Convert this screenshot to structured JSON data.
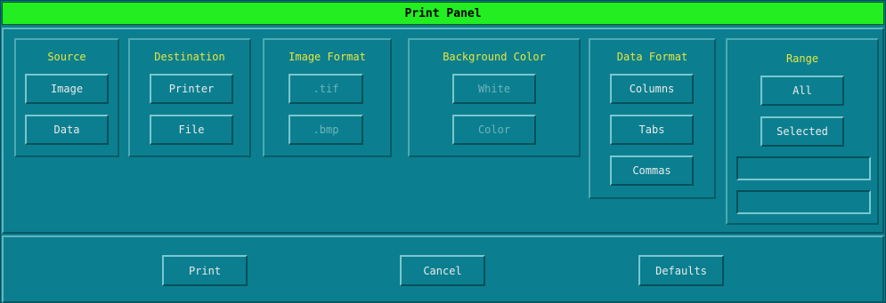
{
  "window": {
    "title": "Print Panel"
  },
  "source": {
    "title": "Source",
    "image": "Image",
    "data": "Data"
  },
  "destination": {
    "title": "Destination",
    "printer": "Printer",
    "file": "File"
  },
  "image_format": {
    "title": "Image Format",
    "tif": ".tif",
    "bmp": ".bmp"
  },
  "background_color": {
    "title": "Background Color",
    "white": "White",
    "color": "Color"
  },
  "data_format": {
    "title": "Data Format",
    "columns": "Columns",
    "tabs": "Tabs",
    "commas": "Commas"
  },
  "range": {
    "title": "Range",
    "all": "All",
    "selected": "Selected",
    "field1": "",
    "field2": ""
  },
  "actions": {
    "print": "Print",
    "cancel": "Cancel",
    "defaults": "Defaults"
  },
  "colors": {
    "title_bar": "#22ee22",
    "background": "#0b7f8f",
    "group_title": "#e6e640",
    "button_text": "#eaeaea",
    "disabled_text": "#6fb3bc"
  }
}
